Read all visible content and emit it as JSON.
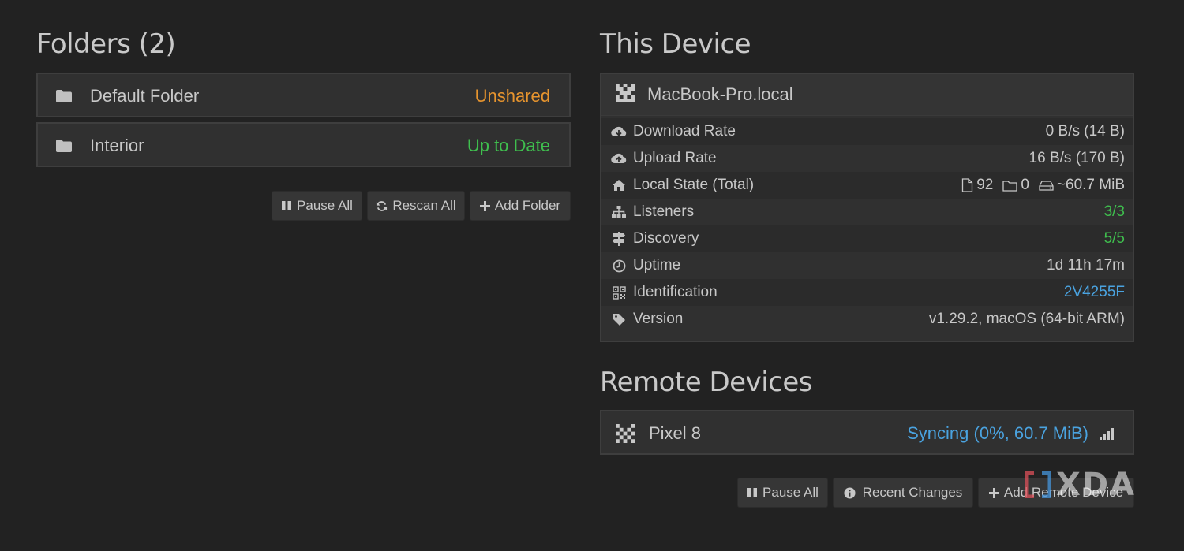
{
  "folders": {
    "title": "Folders (2)",
    "items": [
      {
        "name": "Default Folder",
        "status": "Unshared",
        "status_color": "#e8952e"
      },
      {
        "name": "Interior",
        "status": "Up to Date",
        "status_color": "#3fbf4e"
      }
    ],
    "buttons": {
      "pause_all": "Pause All",
      "rescan_all": "Rescan All",
      "add_folder": "Add Folder"
    }
  },
  "this_device": {
    "title": "This Device",
    "name": "MacBook-Pro.local",
    "stats": [
      {
        "label": "Download Rate",
        "value": "0 B/s (14 B)",
        "icon": "cloud-download-icon"
      },
      {
        "label": "Upload Rate",
        "value": "16 B/s (170 B)",
        "icon": "cloud-upload-icon"
      },
      {
        "label": "Local State (Total)",
        "files": "92",
        "dirs": "0",
        "size": "~60.7 MiB",
        "icon": "home-icon"
      },
      {
        "label": "Listeners",
        "value": "3/3",
        "icon": "sitemap-icon"
      },
      {
        "label": "Discovery",
        "value": "5/5",
        "icon": "signpost-icon"
      },
      {
        "label": "Uptime",
        "value": "1d 11h 17m",
        "icon": "clock-icon"
      },
      {
        "label": "Identification",
        "value": "2V4255F",
        "icon": "qrcode-icon"
      },
      {
        "label": "Version",
        "value": "v1.29.2, macOS (64-bit ARM)",
        "icon": "tag-icon"
      }
    ]
  },
  "remote_devices": {
    "title": "Remote Devices",
    "items": [
      {
        "name": "Pixel 8",
        "status": "Syncing (0%, 60.7 MiB)",
        "status_color": "#4aa3e0"
      }
    ],
    "buttons": {
      "pause_all": "Pause All",
      "recent_changes": "Recent Changes",
      "add_remote": "Add Remote Device"
    }
  },
  "watermark": "XDA",
  "colors": {
    "background": "#222222",
    "panel": "#303030",
    "green": "#3fbf4e",
    "orange": "#e8952e",
    "blue": "#4aa3e0"
  }
}
